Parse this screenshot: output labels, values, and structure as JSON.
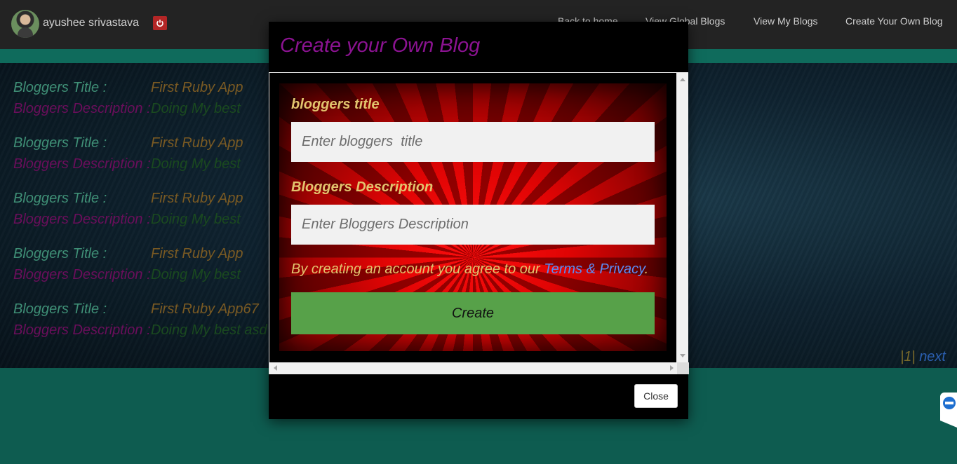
{
  "navbar": {
    "username": "ayushee srivastava",
    "links": [
      "Back to home",
      "View Global Blogs",
      "View My Blogs",
      "Create Your Own Blog"
    ]
  },
  "blogs": [
    {
      "title_label": "Bloggers Title :",
      "title": "First Ruby App",
      "desc_label": "Bloggers Description :",
      "desc": "Doing My best"
    },
    {
      "title_label": "Bloggers Title :",
      "title": "First Ruby App",
      "desc_label": "Bloggers Description :",
      "desc": "Doing My best"
    },
    {
      "title_label": "Bloggers Title :",
      "title": "First Ruby App",
      "desc_label": "Bloggers Description :",
      "desc": "Doing My best"
    },
    {
      "title_label": "Bloggers Title :",
      "title": "First Ruby App",
      "desc_label": "Bloggers Description :",
      "desc": "Doing My best"
    },
    {
      "title_label": "Bloggers Title :",
      "title": "First Ruby App67",
      "desc_label": "Bloggers Description :",
      "desc": "Doing My best asd"
    }
  ],
  "pager": {
    "current": "|1|",
    "next": "next"
  },
  "modal": {
    "title": "Create your Own Blog",
    "title_label": "bloggers title",
    "title_placeholder": "Enter bloggers  title",
    "desc_label": "Bloggers Description",
    "desc_placeholder": "Enter Bloggers Description",
    "terms_text": "By creating an account you agree to our ",
    "terms_link": "Terms & Privacy",
    "terms_end": ".",
    "create_label": "Create",
    "close_label": "Close"
  },
  "colors": {
    "accent_teal": "#0e5c50",
    "modal_title": "#8b1391",
    "create_button": "#57a149",
    "terms_link": "#5b8cf5"
  }
}
